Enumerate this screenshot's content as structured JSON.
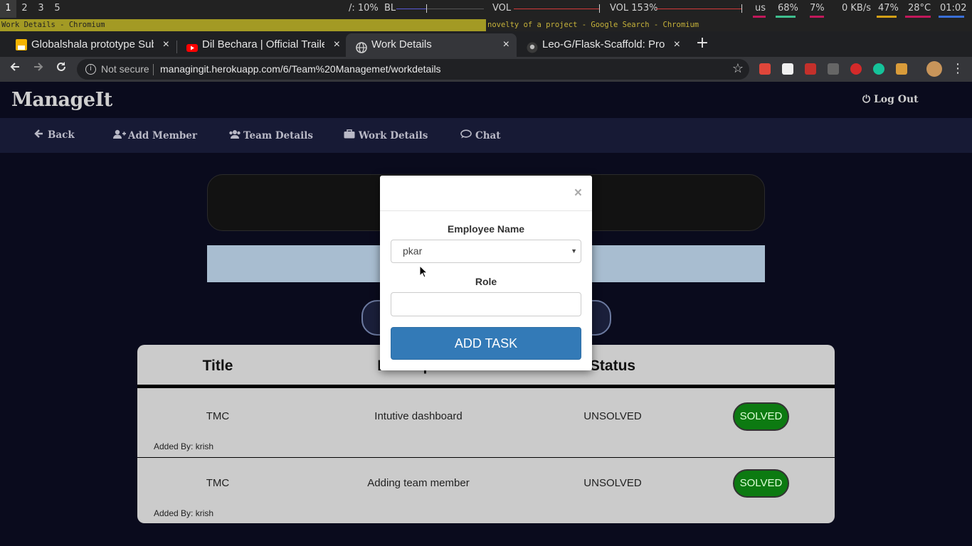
{
  "system_bar": {
    "workspaces": [
      "1",
      "2",
      "3",
      "5"
    ],
    "active_workspace": "1",
    "brightness": "/: 10%",
    "bl_label": "BL",
    "vol_label": "VOL",
    "vol2": "VOL 153%",
    "kbd_layout": "us",
    "cpu": "68%",
    "mem": "7%",
    "net": "0 KB/s",
    "battery": "47%",
    "temp": "28°C",
    "clock": "01:02"
  },
  "window_titles": {
    "active": "Work Details - Chromium",
    "other": "novelty of a project - Google Search - Chromium"
  },
  "browser": {
    "tabs": [
      {
        "label": "Globalshala prototype Sub",
        "icon": "slides-icon",
        "active": false
      },
      {
        "label": "Dil Bechara | Official Traile",
        "icon": "youtube-icon",
        "active": false
      },
      {
        "label": "Work Details",
        "icon": "globe-icon",
        "active": true
      },
      {
        "label": "Leo-G/Flask-Scaffold: Pro",
        "icon": "github-icon",
        "active": false
      }
    ],
    "close_glyph": "×",
    "new_tab_glyph": "+",
    "security_label": "Not secure",
    "url": "managingit.herokuapp.com/6/Team%20Managemet/workdetails"
  },
  "app": {
    "brand": "ManageIt",
    "logout": "Log Out",
    "nav": [
      {
        "label": "Back",
        "icon": "arrow-left-icon"
      },
      {
        "label": "Add Member",
        "icon": "user-plus-icon"
      },
      {
        "label": "Team Details",
        "icon": "users-icon"
      },
      {
        "label": "Work Details",
        "icon": "briefcase-icon"
      },
      {
        "label": "Chat",
        "icon": "chat-icon"
      }
    ],
    "table": {
      "headers": [
        "Title",
        "Description",
        "Status"
      ],
      "rows": [
        {
          "title": "TMC",
          "description": "Intutive dashboard",
          "status": "UNSOLVED",
          "action": "SOLVED",
          "added_by": "Added By: krish"
        },
        {
          "title": "TMC",
          "description": "Adding team member",
          "status": "UNSOLVED",
          "action": "SOLVED",
          "added_by": "Added By: krish"
        }
      ]
    }
  },
  "modal": {
    "close": "×",
    "employee_label": "Employee Name",
    "employee_value": "pkar",
    "role_label": "Role",
    "role_value": "",
    "submit": "ADD TASK"
  },
  "colors": {
    "page_bg": "#0a0b1d",
    "nav_bg": "#171a35",
    "primary_button": "#337ab7",
    "solved_button": "#0c7a11"
  }
}
